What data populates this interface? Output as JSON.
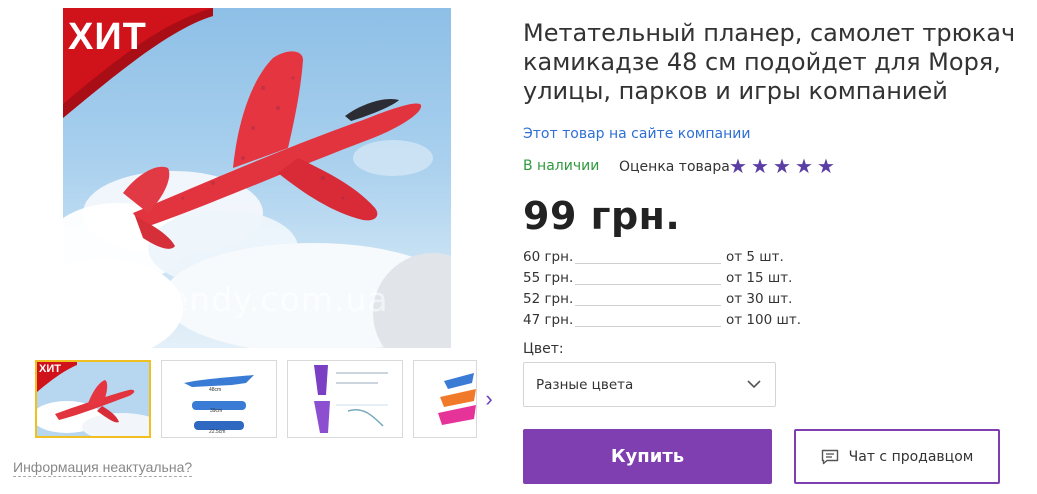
{
  "product": {
    "title": "Метательный планер, самолет трюкач камикадзе 48 см подойдет для Моря, улицы, парков и игры компанией",
    "company_link": "Этот товар на сайте компании",
    "stock_status": "В наличии",
    "rating_label": "Оценка товара",
    "rating_stars": 5,
    "price": "99 грн.",
    "watermark": "atrendy.com.ua",
    "badge": "ХИТ"
  },
  "tiers": [
    {
      "price": "60 грн.",
      "qty": "от 5 шт."
    },
    {
      "price": "55 грн.",
      "qty": "от 15 шт."
    },
    {
      "price": "52 грн.",
      "qty": "от 30 шт."
    },
    {
      "price": "47 грн.",
      "qty": "от 100 шт."
    }
  ],
  "color": {
    "label": "Цвет:",
    "selected": "Разные цвета"
  },
  "buttons": {
    "buy": "Купить",
    "chat": "Чат с продавцом"
  },
  "gallery": {
    "info_link": "Информация неактуальна?",
    "thumb_badge": "ХИТ",
    "thumb_labels": [
      "48cm",
      "39cm",
      "22.5cm"
    ]
  },
  "colors": {
    "accent": "#7f3fb0",
    "star": "#5b3ea4",
    "stock": "#2e9a3c",
    "link": "#2f6fd6",
    "badge": "#d0121b"
  }
}
